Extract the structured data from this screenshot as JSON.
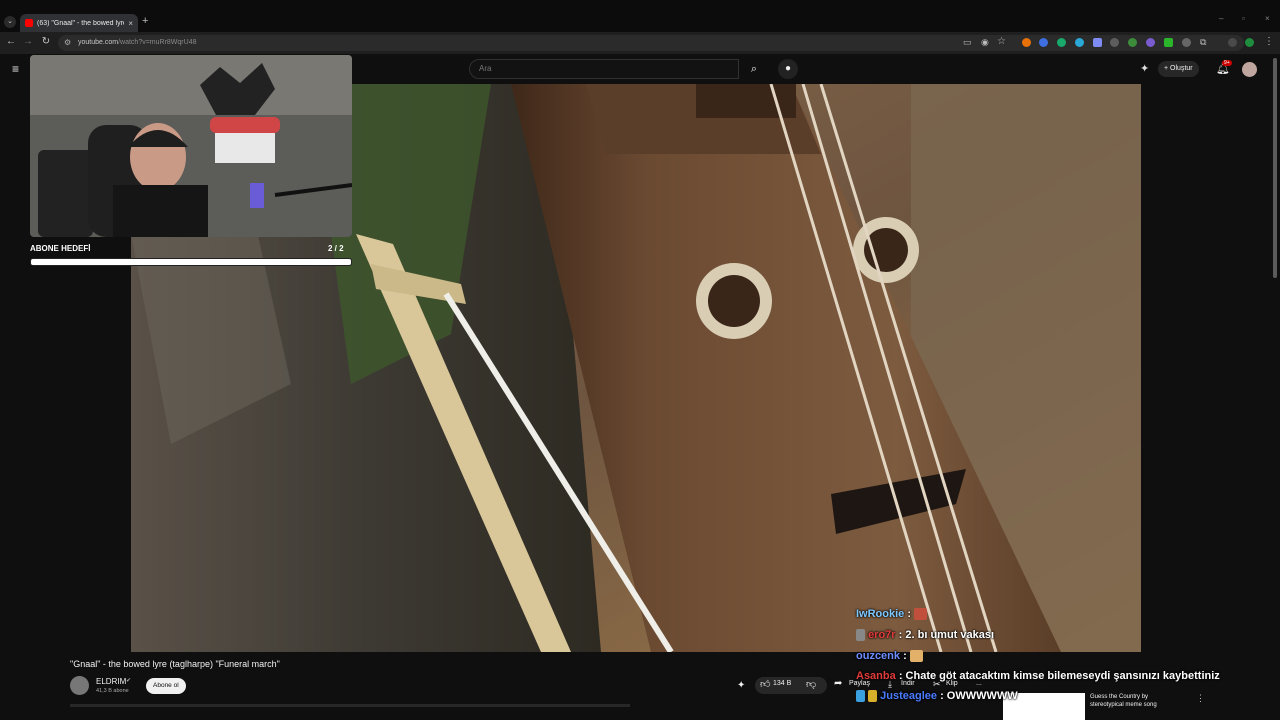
{
  "browser": {
    "tab_title": "(63) \"Gnaal\" - the bowed lyre (t",
    "tab_close": "×",
    "new_tab": "+",
    "tab_search": "⌄",
    "address_host": "youtube.com",
    "address_path": "/watch?v=muRr8WqrU48",
    "win_min": "–",
    "win_max": "▫",
    "win_close": "×"
  },
  "youtube": {
    "search_placeholder": "Ara",
    "create_label": "Oluştur",
    "notification_badge": "9+"
  },
  "stream_overlay": {
    "goal_label": "ABONE HEDEFİ",
    "goal_count": "2 / 2",
    "goal_progress": 1.0
  },
  "video": {
    "title": "\"Gnaal\" - the bowed lyre (taglharpe) \"Funeral march\"",
    "channel_name": "ELDRIM",
    "subscriber_count": "41,3 B abone",
    "subscribe_label": "Abone ol",
    "like_count": "134 B",
    "share_label": "Paylaş",
    "download_label": "İndir",
    "clip_label": "Klip",
    "more_label": "..."
  },
  "related": {
    "title_line1": "Guess the Country by",
    "title_line2": "stereotypical meme song"
  },
  "chat": [
    {
      "user": "IwRookie",
      "user_color": "#7fc8ff",
      "sep": ":",
      "text": ""
    },
    {
      "user": "ero7r",
      "user_color": "#e23b3b",
      "sep": ":",
      "text": "2. bı umut vakası"
    },
    {
      "user": "ouzcenk",
      "user_color": "#6c8cff",
      "sep": ":",
      "text": ""
    },
    {
      "user": "Asanba",
      "user_color": "#e23b3b",
      "sep": ":",
      "text": "Chate göt atacaktım kimse bilemeseydi şansınızı kaybettiniz"
    },
    {
      "user": "Justeaglee",
      "user_color": "#4b7bff",
      "sep": ":",
      "text": "OWWWWWW"
    }
  ]
}
